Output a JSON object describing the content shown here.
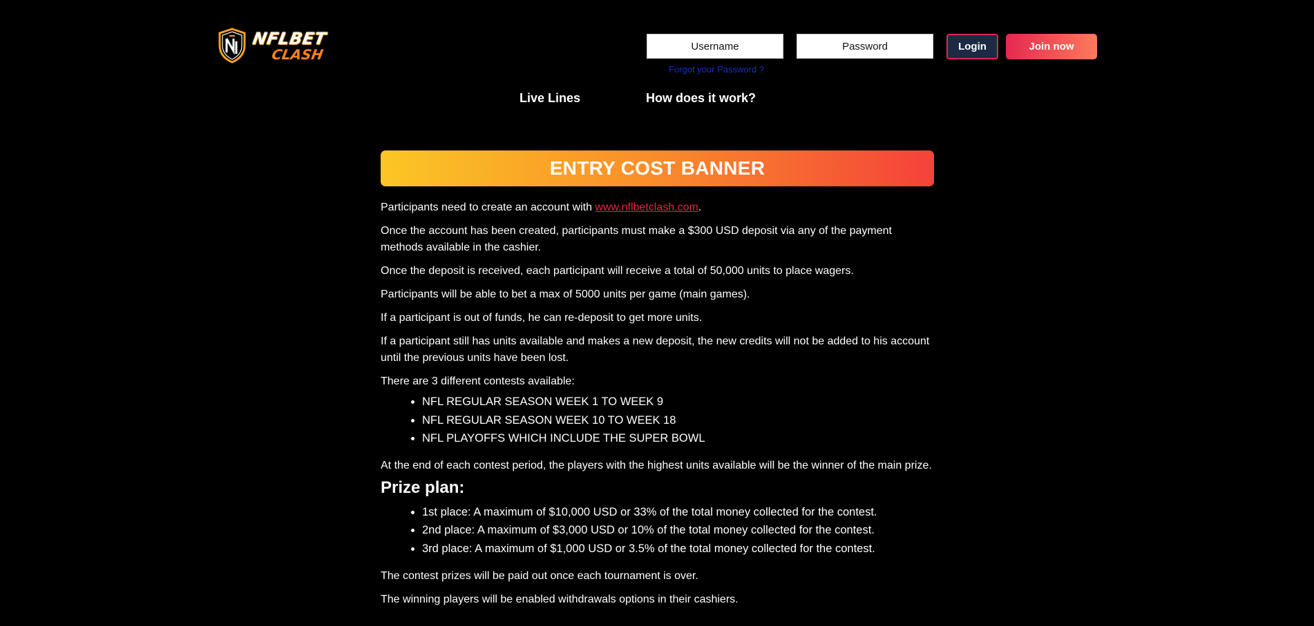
{
  "header": {
    "logo": {
      "line1": "NFLBET",
      "line2": "CLASH",
      "icon": "shield-logo-icon",
      "colors": {
        "primary": "#f7a21b",
        "secondary": "#f58220"
      }
    },
    "login": {
      "username_placeholder": "Username",
      "password_placeholder": "Password",
      "login_label": "Login",
      "join_label": "Join now",
      "forgot_label": "Forgot your Password ?"
    },
    "nav": {
      "live_lines": "Live Lines",
      "how_it_works": "How does it work?"
    }
  },
  "banner": {
    "title": "ENTRY COST BANNER",
    "gradient": [
      "#fbc725",
      "#f98c2a",
      "#f5423a"
    ]
  },
  "content": {
    "p1_prefix": "Participants need to create an account with ",
    "p1_link": "www.nflbetclash.com",
    "p1_suffix": ".",
    "p2": "Once the account has been created, participants must make a $300 USD deposit via any of the payment methods available in the cashier.",
    "p3": "Once the deposit is received, each participant will receive a total of 50,000 units to place wagers.",
    "p4": "Participants will be able to bet a max of 5000 units per game (main games).",
    "p5": "If a participant is out of funds, he can re-deposit to get more units.",
    "p6": "If a participant still has units available and makes a new deposit, the new credits will not be added to his account until the previous units have been lost.",
    "p7": "There are 3 different contests available:",
    "contests": [
      "NFL REGULAR SEASON WEEK 1 TO WEEK 9",
      "NFL REGULAR SEASON WEEK 10 TO WEEK 18",
      "NFL PLAYOFFS WHICH INCLUDE THE SUPER BOWL"
    ],
    "p8": "At the end of each contest period, the players with the highest units available will be the winner of the main prize.",
    "prize_heading": "Prize plan:",
    "prizes": [
      "1st place: A maximum of $10,000 USD or 33% of the total money collected for the contest.",
      "2nd place: A maximum of $3,000 USD or 10% of the total money collected for the contest.",
      "3rd place: A maximum of $1,000 USD or 3.5% of the total money collected for the contest."
    ],
    "p9": "The contest prizes will be paid out once each tournament is over.",
    "p10": "The winning players will be enabled withdrawals options in their cashiers."
  },
  "colors": {
    "background": "#000000",
    "link": "#e8263e",
    "forgot_link": "#1c2fb8",
    "login_border": "#e0294f",
    "login_bg": "#1d2a44"
  }
}
